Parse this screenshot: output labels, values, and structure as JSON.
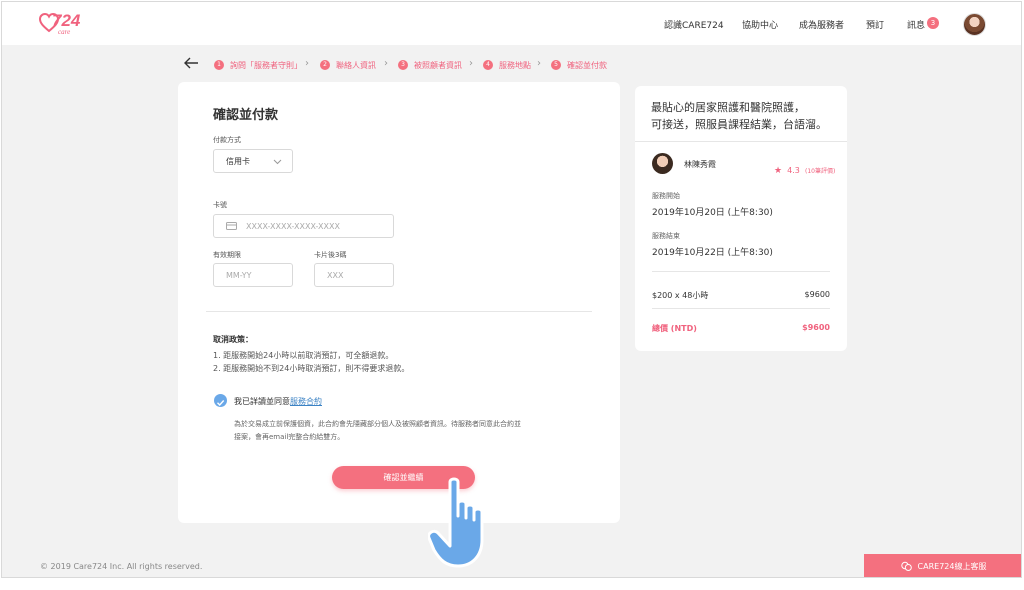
{
  "header": {
    "logo_number": "724",
    "logo_sub": "care",
    "nav": [
      "認識CARE724",
      "協助中心",
      "成為服務者",
      "預訂"
    ],
    "messages_label": "訊息",
    "messages_count": "3"
  },
  "steps": [
    {
      "num": "1",
      "label": "詢問「服務者守則」"
    },
    {
      "num": "2",
      "label": "聯絡人資訊"
    },
    {
      "num": "3",
      "label": "被照顧者資訊"
    },
    {
      "num": "4",
      "label": "服務地點"
    },
    {
      "num": "5",
      "label": "確認並付款"
    }
  ],
  "form": {
    "title": "確認並付款",
    "payment_method_label": "付款方式",
    "payment_method_value": "信用卡",
    "card_number_label": "卡號",
    "card_number_placeholder": "XXXX-XXXX-XXXX-XXXX",
    "expiry_label": "有效期限",
    "expiry_placeholder": "MM-YY",
    "cvv_label": "卡片後3碼",
    "cvv_placeholder": "XXX",
    "policy_title": "取消政策：",
    "policy_items": [
      "1.  距服務開始24小時以前取消預訂，可全額退款。",
      "2.  距服務開始不到24小時取消預訂，則不得要求退款。"
    ],
    "agree_prefix": "我已詳讀並同意",
    "agree_link": "服務合約",
    "note_line1": "為於交易成立前保護個資，此合約會先隱藏部分個人及被照顧者資訊。待服務者同意此合約並",
    "note_line2": "接案，會再email完整合約給雙方。",
    "confirm_label": "確認並繼續"
  },
  "summary": {
    "headline_line1": "最貼心的居家照護和醫院照護，",
    "headline_line2": "可接送，照服員課程結業，台語溜。",
    "caregiver_name": "林陳秀霞",
    "rating": "4.3",
    "rating_count": "(10筆評價)",
    "start_label": "服務開始",
    "start_value": "2019年10月20日 (上午8:30)",
    "end_label": "服務結束",
    "end_value": "2019年10月22日 (上午8:30)",
    "rate_label": "$200 x 48小時",
    "rate_value": "$9600",
    "total_label": "總價 (NTD)",
    "total_value": "$9600"
  },
  "footer": {
    "copyright": "© 2019 Care724 Inc. All rights reserved.",
    "support_label": "CARE724線上客服"
  },
  "colors": {
    "brand": "#f4707f",
    "link": "#3b82c4",
    "check": "#6aa8e8",
    "background": "#f2f2f2"
  }
}
